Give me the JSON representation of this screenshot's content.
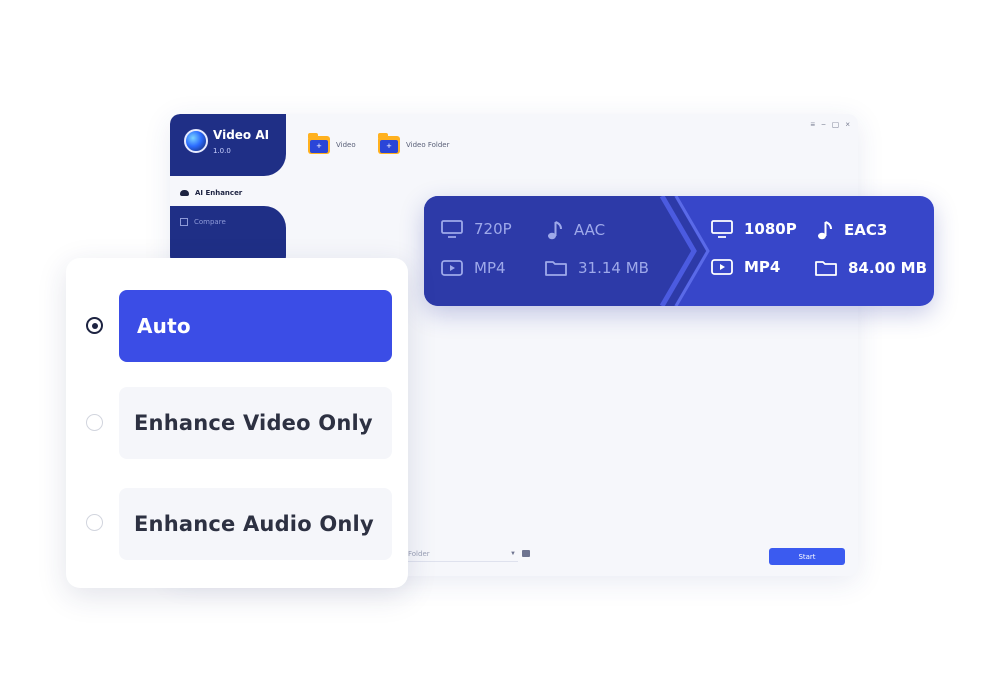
{
  "app": {
    "title": "Video AI",
    "version": "1.0.0"
  },
  "sidebar": {
    "items": [
      {
        "label": "AI Enhancer"
      },
      {
        "label": "Compare"
      }
    ]
  },
  "toolbar": {
    "add_video_label": "Video",
    "add_folder_label": "Video Folder"
  },
  "window_controls": [
    "≡",
    "−",
    "▢",
    "×"
  ],
  "footer": {
    "output_folder_value": "Folder",
    "start_label": "Start"
  },
  "conversion": {
    "source": {
      "resolution": "720P",
      "audio_codec": "AAC",
      "format": "MP4",
      "size": "31.14 MB"
    },
    "target": {
      "resolution": "1080P",
      "audio_codec": "EAC3",
      "format": "MP4",
      "size": "84.00 MB"
    }
  },
  "modes": {
    "selected": "Auto",
    "options": [
      {
        "label": "Auto"
      },
      {
        "label": "Enhance Video Only"
      },
      {
        "label": "Enhance Audio Only"
      }
    ]
  },
  "colors": {
    "accent": "#3b4de6",
    "navy": "#1f2f86",
    "card_dark": "#2d3aa8",
    "card_light": "#3746c9"
  }
}
